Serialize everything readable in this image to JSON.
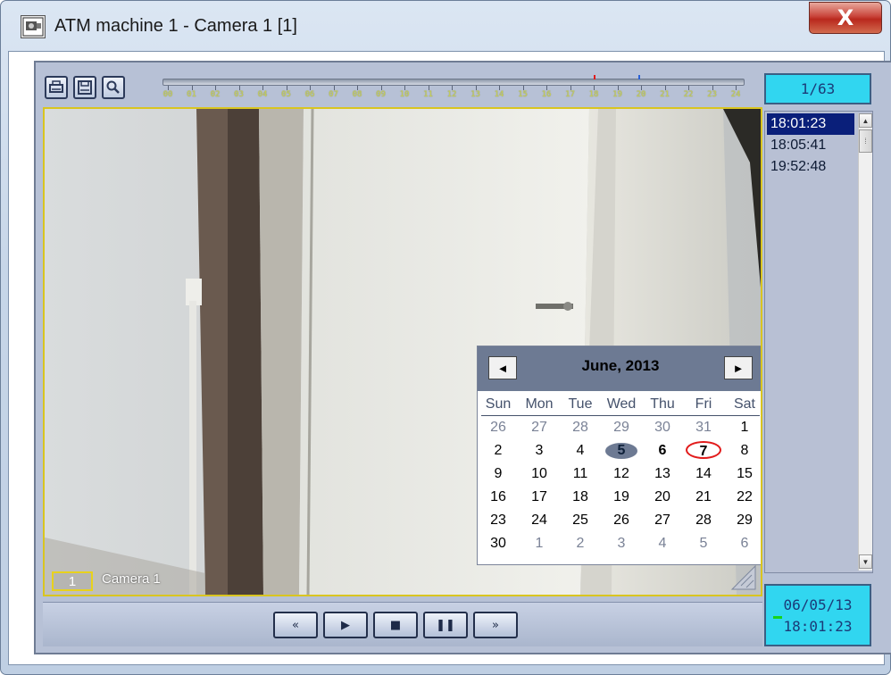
{
  "window": {
    "title": "ATM machine 1 - Camera 1 [1]",
    "close_label": "X"
  },
  "toolbar": {
    "buttons": [
      "printer-icon",
      "save-icon",
      "zoom-icon"
    ]
  },
  "timeline": {
    "hours": [
      "00",
      "01",
      "02",
      "03",
      "04",
      "05",
      "06",
      "07",
      "08",
      "09",
      "10",
      "11",
      "12",
      "13",
      "14",
      "15",
      "16",
      "17",
      "18",
      "19",
      "20",
      "21",
      "22",
      "23",
      "24"
    ]
  },
  "counter": "1/63",
  "camera": {
    "number": "1",
    "name": "Camera 1"
  },
  "calendar": {
    "title": "June, 2013",
    "prev_label": "◄",
    "next_label": "►",
    "weekdays": [
      "Sun",
      "Mon",
      "Tue",
      "Wed",
      "Thu",
      "Fri",
      "Sat"
    ],
    "weeks": [
      [
        "26",
        "27",
        "28",
        "29",
        "30",
        "31",
        "1"
      ],
      [
        "2",
        "3",
        "4",
        "5",
        "6",
        "7",
        "8"
      ],
      [
        "9",
        "10",
        "11",
        "12",
        "13",
        "14",
        "15"
      ],
      [
        "16",
        "17",
        "18",
        "19",
        "20",
        "21",
        "22"
      ],
      [
        "23",
        "24",
        "25",
        "26",
        "27",
        "28",
        "29"
      ],
      [
        "30",
        "1",
        "2",
        "3",
        "4",
        "5",
        "6"
      ]
    ]
  },
  "timelist": {
    "items": [
      "18:01:23",
      "18:05:41",
      "19:52:48"
    ],
    "selected_index": 0
  },
  "datetime": {
    "date": "06/05/13",
    "time": "18:01:23"
  },
  "playback": {
    "buttons": [
      {
        "name": "rewind-button",
        "label": "«"
      },
      {
        "name": "play-button",
        "label": "▶"
      },
      {
        "name": "stop-button",
        "label": "■"
      },
      {
        "name": "pause-button",
        "label": "❚❚"
      },
      {
        "name": "fast-forward-button",
        "label": "»"
      }
    ]
  },
  "colors": {
    "accent_cyan": "#31d6f0",
    "selection_navy": "#0a1f7a",
    "today_ring": "#e21b1b",
    "video_border": "#d9c520"
  }
}
